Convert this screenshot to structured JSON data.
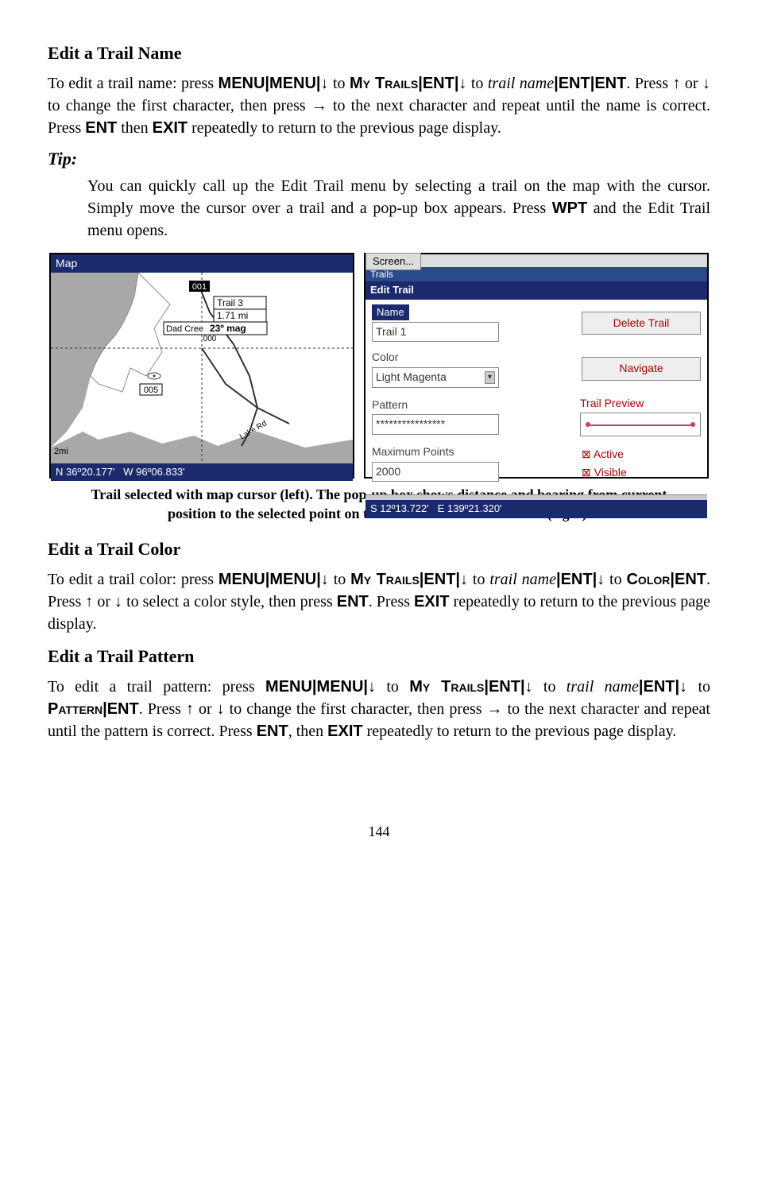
{
  "section1": {
    "heading": "Edit a Trail Name",
    "p1a": "To edit a trail name: press ",
    "p1b": " to ",
    "p1c": " to ",
    "p1d": ". Press ",
    "p1e": " or ",
    "p1f": " to change the first character, then press ",
    "p1g": " to the next character and repeat until the name is correct. Press ",
    "p1h": " then ",
    "p1i": " repeatedly to return to the previous page display.",
    "menu": "MENU",
    "mytrails": "My Trails",
    "ent": "ENT",
    "trailname": "trail name",
    "exit": "EXIT",
    "up": "↑",
    "down": "↓",
    "right": "→",
    "bar": "|"
  },
  "tip": {
    "heading": "Tip:",
    "body": "You can quickly call up the Edit Trail menu by selecting a trail on the map with the cursor. Simply move the cursor over a trail and a pop-up box appears. Press ",
    "wpt": "WPT",
    "body2": " and the Edit Trail menu opens."
  },
  "figleft": {
    "title": "Map",
    "wpt1": "001",
    "trail_label": "Trail 3",
    "dist": "1.71 mi",
    "bearing_pre": "Dad Cree",
    "bearing": "23º mag",
    "wpt_over": "000",
    "wpt2": "005",
    "road": "Lake Rd",
    "scale": "2mi",
    "lat": "N   36º20.177'",
    "lon": "W   96º06.833'"
  },
  "figright": {
    "screen_btn": "Screen...",
    "title_trails": "Trails",
    "title_edit": "Edit Trail",
    "name_label": "Name",
    "name_val": "Trail 1",
    "btn_delete": "Delete Trail",
    "color_label": "Color",
    "color_val": "Light Magenta",
    "btn_nav": "Navigate",
    "pattern_label": "Pattern",
    "pattern_val": "****************",
    "preview_label": "Trail Preview",
    "max_label": "Maximum Points",
    "max_val": "2000",
    "chk_active": "⊠ Active",
    "chk_visible": "⊠ Visible",
    "lat": "S   12º13.722'",
    "lon": "E  139º21.320'"
  },
  "caption": "Trail selected with map cursor (left). The pop-up box shows distance and bearing from current position to the selected point on the trail. The Edit Trail menu (right).",
  "section2": {
    "heading": "Edit a Trail Color",
    "p_a": "To edit a trail color: press ",
    "p_b": " to ",
    "p_c": " to ",
    "p_d": " to ",
    "p_e": ". Press ",
    "p_f": " or ",
    "p_g": " to select a color style, then press ",
    "p_h": ". Press ",
    "p_i": " repeatedly to return to the previous page display.",
    "color": "Color"
  },
  "section3": {
    "heading": "Edit a Trail Pattern",
    "p_a": "To edit a trail pattern: press ",
    "p_b": " to ",
    "p_c": " to ",
    "p_d": " to ",
    "p_e": ". Press ",
    "p_f": " or ",
    "p_g": " to change the first character, then press ",
    "p_h": " to the next character and repeat until the pattern is correct. Press ",
    "p_i": ", then ",
    "p_j": " repeatedly to return to the previous page display.",
    "pattern": "Pattern"
  },
  "page": "144"
}
